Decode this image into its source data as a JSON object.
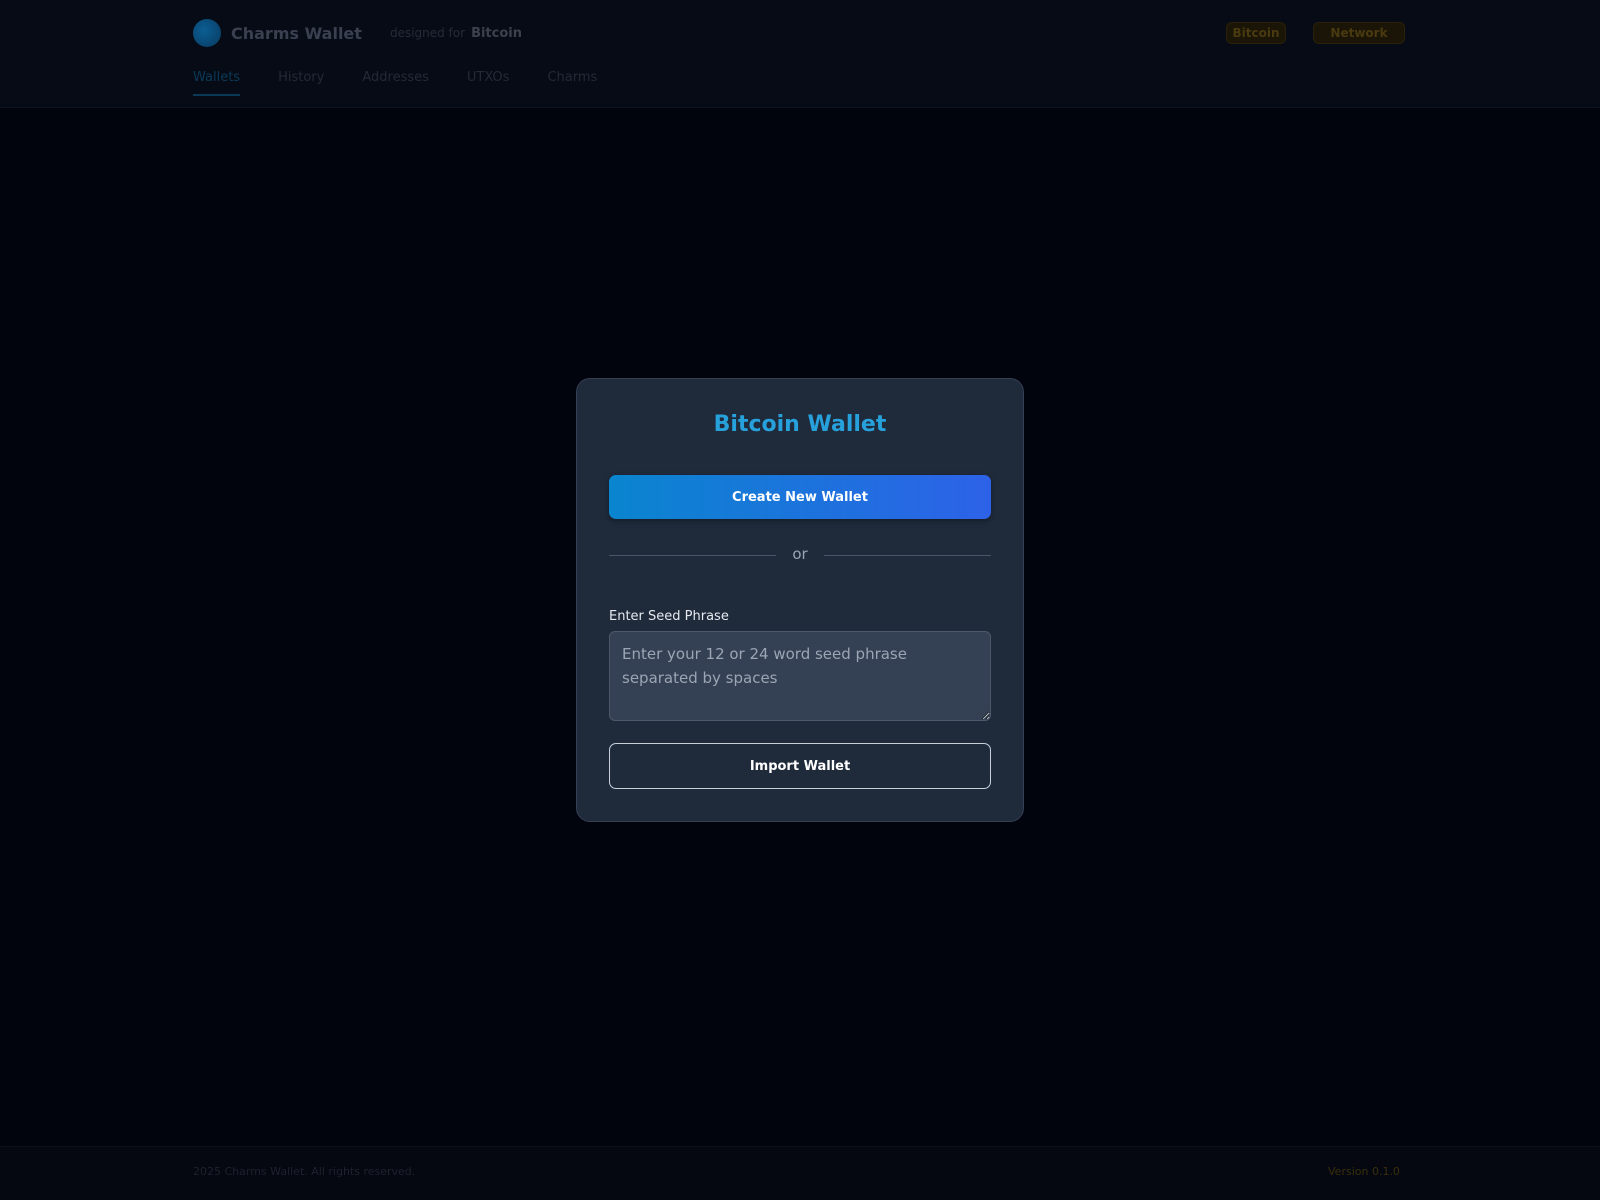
{
  "header": {
    "brand_name": "Charms Wallet",
    "designed_for_label": "designed for",
    "designed_for_brand": "Bitcoin",
    "button_1": "Bitcoin",
    "button_2": "Network"
  },
  "tabs": [
    {
      "label": "Wallets",
      "active": true
    },
    {
      "label": "History",
      "active": false
    },
    {
      "label": "Addresses",
      "active": false
    },
    {
      "label": "UTXOs",
      "active": false
    },
    {
      "label": "Charms",
      "active": false
    }
  ],
  "modal": {
    "title": "Bitcoin Wallet",
    "create_button": "Create New Wallet",
    "divider_text": "or",
    "seed_label": "Enter Seed Phrase",
    "seed_placeholder": "Enter your 12 or 24 word seed phrase separated by spaces",
    "seed_value": "",
    "import_button": "Import Wallet"
  },
  "footer": {
    "copyright": "2025 Charms Wallet. All rights reserved.",
    "version": "Version 0.1.0"
  },
  "colors": {
    "accent": "#27a1dc",
    "create_gradient_start": "#0a85cf",
    "create_gradient_end": "#2d62e8",
    "modal_bg": "#1f2a3b",
    "page_bg": "#02040d"
  }
}
